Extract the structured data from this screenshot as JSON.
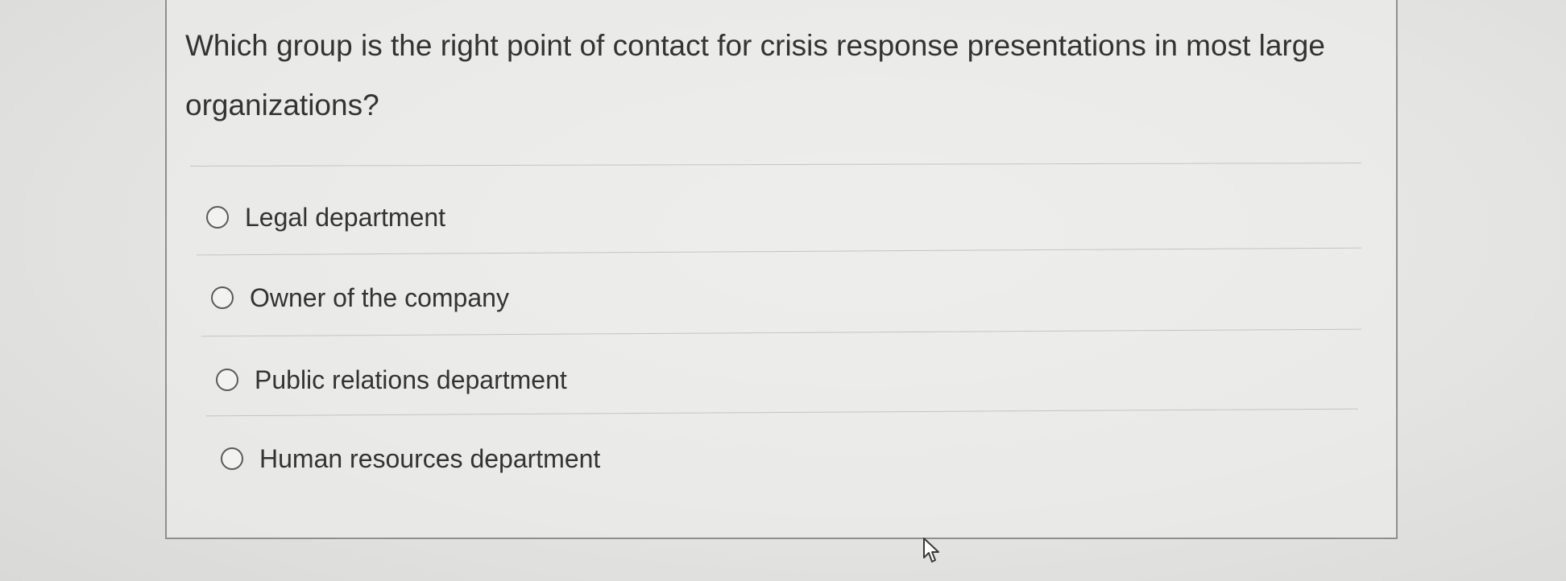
{
  "question": {
    "text": "Which group is the right point of contact for crisis response presentations in most large organizations?"
  },
  "options": [
    {
      "label": "Legal department",
      "selected": false
    },
    {
      "label": "Owner of the company",
      "selected": false
    },
    {
      "label": "Public relations department",
      "selected": false
    },
    {
      "label": "Human resources department",
      "selected": false
    }
  ],
  "colors": {
    "text": "#333333",
    "border": "#8f8f8f",
    "divider": "#c4c4c2",
    "background": "#e6e6e4"
  },
  "icons": {
    "radio": "radio-unchecked-icon",
    "cursor": "mouse-pointer-icon"
  }
}
